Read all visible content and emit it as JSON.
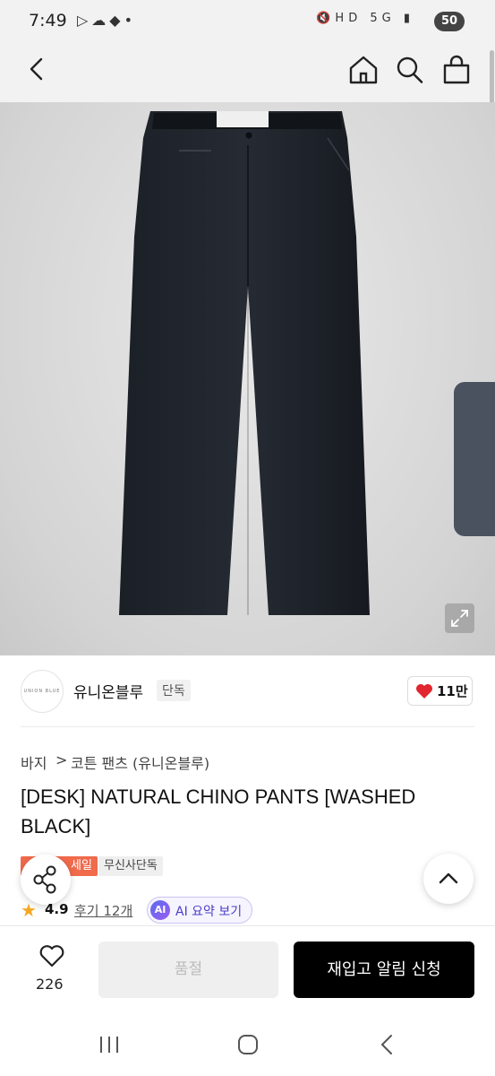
{
  "status_bar": {
    "time": "7:49",
    "battery": "50"
  },
  "brand": {
    "name": "유니온블루",
    "tag": "단독",
    "logo_text": "UNION BLUE"
  },
  "like": {
    "count": "11만"
  },
  "breadcrumb": {
    "category": "바지",
    "separator": ">",
    "subcategory": "코튼 팬츠 (유니온블루)"
  },
  "product": {
    "title": "[DESK] NATURAL CHINO PANTS [WASHED BLACK]",
    "badges": [
      "세일",
      "무신사단독"
    ],
    "rating": "4.9",
    "reviews": "후기 12개",
    "ai_summary": "AI 요약 보기",
    "ai_badge": "AI"
  },
  "bottom_bar": {
    "wish_count": "226",
    "option_label": "품절",
    "restock_label": "재입고 알림 신청"
  },
  "colors": {
    "sale": "#f06a4c",
    "heart": "#e1262f",
    "primary_button": "#000000",
    "ai_accent": "#4b3fc7"
  }
}
